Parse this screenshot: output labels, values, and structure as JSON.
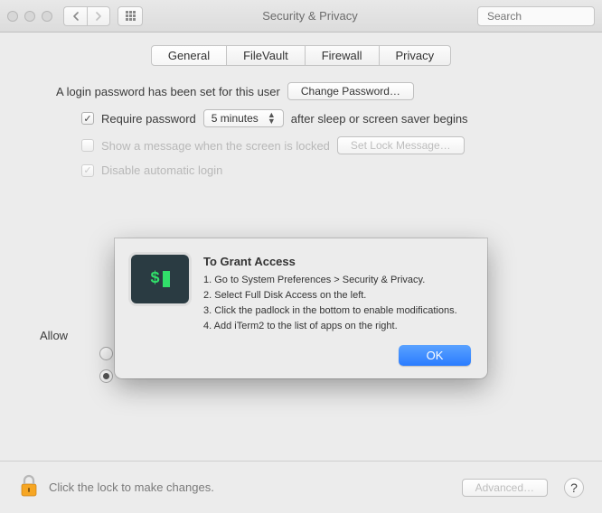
{
  "window": {
    "title": "Security & Privacy",
    "search_placeholder": "Search"
  },
  "tabs": [
    "General",
    "FileVault",
    "Firewall",
    "Privacy"
  ],
  "active_tab": 0,
  "general": {
    "password_set_text": "A login password has been set for this user",
    "change_password_btn": "Change Password…",
    "require_pw_label": "Require password",
    "delay_value": "5 minutes",
    "require_pw_suffix": "after sleep or screen saver begins",
    "show_message_label": "Show a message when the screen is locked",
    "set_lock_btn": "Set Lock Message…",
    "disable_auto_login": "Disable automatic login",
    "allow_label": "Allow"
  },
  "bottom": {
    "lock_text": "Click the lock to make changes.",
    "advanced_btn": "Advanced…"
  },
  "modal": {
    "icon_name": "terminal-icon",
    "title": "To Grant Access",
    "steps": [
      "1. Go to System Preferences > Security & Privacy.",
      "2. Select Full Disk Access on the left.",
      "3. Click the padlock in the bottom to enable modifications.",
      "4. Add iTerm2 to the list of apps on the right."
    ],
    "ok": "OK"
  }
}
